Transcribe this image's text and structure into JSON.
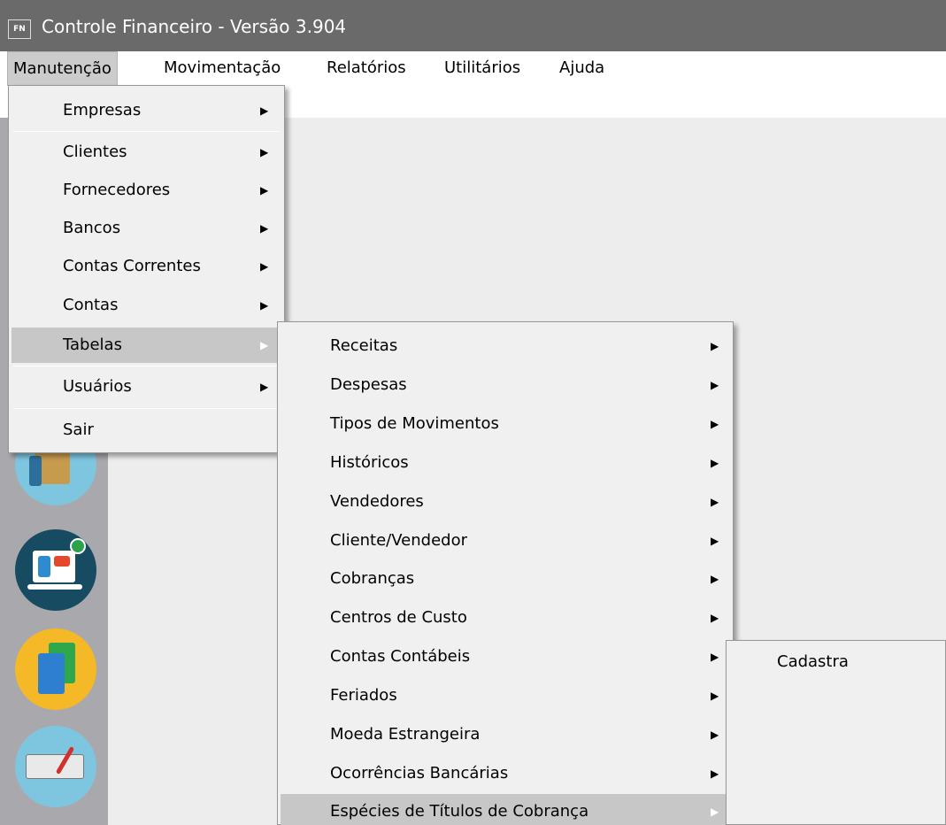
{
  "window": {
    "icon_text": "FN",
    "title": "Controle Financeiro - Versão 3.904"
  },
  "menubar": [
    "Manutenção",
    "Movimentação",
    "Relatórios",
    "Utilitários",
    "Ajuda"
  ],
  "menu_manutencao": [
    "Empresas",
    "Clientes",
    "Fornecedores",
    "Bancos",
    "Contas Correntes",
    "Contas",
    "Tabelas",
    "Usuários",
    "Sair"
  ],
  "menu_tabelas": [
    "Receitas",
    "Despesas",
    "Tipos de Movimentos",
    "Históricos",
    "Vendedores",
    "Cliente/Vendedor",
    "Cobranças",
    "Centros de Custo",
    "Contas Contábeis",
    "Feriados",
    "Moeda Estrangeira",
    "Ocorrências Bancárias",
    "Espécies de Títulos de Cobrança"
  ],
  "menu_especies": [
    "Cadastra"
  ],
  "icons": {
    "submenu_arrow": "▶"
  }
}
